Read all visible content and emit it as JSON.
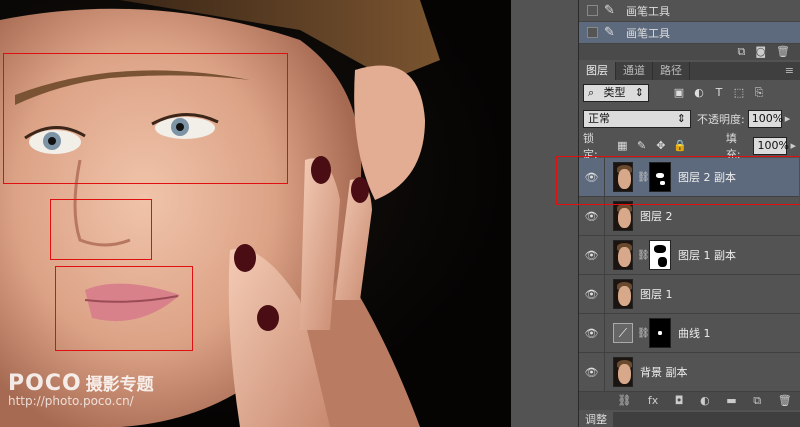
{
  "history": {
    "items": [
      {
        "label": "画笔工具",
        "selected": false
      },
      {
        "label": "画笔工具",
        "selected": true
      }
    ]
  },
  "tabs": [
    {
      "label": "图层",
      "active": true
    },
    {
      "label": "通道",
      "active": false
    },
    {
      "label": "路径",
      "active": false
    }
  ],
  "filter": {
    "kind": "类型"
  },
  "blend": {
    "mode": "正常",
    "opacity_label": "不透明度:",
    "opacity": "100%"
  },
  "lock": {
    "label": "锁定:",
    "fill_label": "填充:",
    "fill": "100%"
  },
  "layers": [
    {
      "name": "图层 2 副本",
      "mask": "black",
      "selected": true
    },
    {
      "name": "图层 2",
      "mask": "none",
      "selected": false
    },
    {
      "name": "图层 1 副本",
      "mask": "white",
      "selected": false
    },
    {
      "name": "图层 1",
      "mask": "none",
      "selected": false
    },
    {
      "name": "曲线 1",
      "mask": "black",
      "adjustment": true,
      "selected": false
    },
    {
      "name": "背景 副本",
      "mask": "none",
      "selected": false
    }
  ],
  "adjust_tab": "调整",
  "watermark": {
    "logo": "POCO",
    "sub": "摄影专题",
    "url": "http://photo.poco.cn/"
  },
  "colors": {
    "highlight": "#e01010",
    "selected_row": "#5d6a7d",
    "panel": "#535353"
  }
}
